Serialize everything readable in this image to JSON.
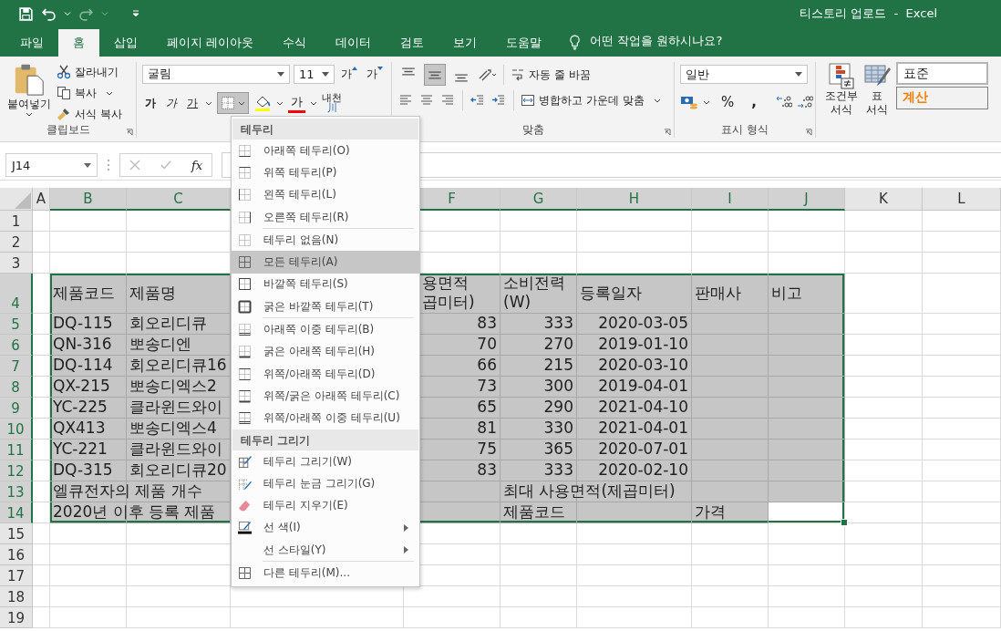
{
  "title_bar": {
    "title": "티스토리 업로드  -  Excel",
    "redo_disabled": true
  },
  "tabs": [
    {
      "label": "파일",
      "selected": false
    },
    {
      "label": "홈",
      "selected": true
    },
    {
      "label": "삽입",
      "selected": false
    },
    {
      "label": "페이지 레이아웃",
      "selected": false
    },
    {
      "label": "수식",
      "selected": false
    },
    {
      "label": "데이터",
      "selected": false
    },
    {
      "label": "검토",
      "selected": false
    },
    {
      "label": "보기",
      "selected": false
    },
    {
      "label": "도움말",
      "selected": false
    }
  ],
  "tell_me": {
    "text": "어떤 작업을 원하시나요?"
  },
  "clipboard": {
    "paste": "붙여넣기",
    "cut": "잘라내기",
    "copy": "복사",
    "format_painter": "서식 복사",
    "label": "클립보드"
  },
  "font": {
    "font_name": "굴림",
    "font_size": "11",
    "grow": "가",
    "shrink": "가",
    "bold": "가",
    "italic": "가",
    "underline": "가",
    "border_pressed": true,
    "font_color": "가",
    "phonetic_top": "내천",
    "phonetic_bottom": "川"
  },
  "alignment": {
    "vertical": [
      {
        "kind": "top",
        "selected": false
      },
      {
        "kind": "middle",
        "selected": true
      },
      {
        "kind": "bottom",
        "selected": false
      }
    ],
    "wrap": "자동 줄 바꿈",
    "merge": "병합하고 가운데 맞춤",
    "label": "맞춤"
  },
  "number": {
    "format": "일반",
    "percent": "%",
    "comma": ",",
    "label": "표시 형식"
  },
  "styles": {
    "conditional": "조건부\n서식",
    "table": "표\n서식",
    "cell_styles": [
      {
        "label": "표준",
        "kind": "normal"
      },
      {
        "label": "계산",
        "kind": "calculation"
      }
    ]
  },
  "formula_bar": {
    "name_box": "J14",
    "fx": "fx"
  },
  "sheet": {
    "columns": [
      {
        "label": "A",
        "selected": false
      },
      {
        "label": "B",
        "selected": true
      },
      {
        "label": "C",
        "selected": true
      },
      {
        "label": "F",
        "selected": true
      },
      {
        "label": "G",
        "selected": true
      },
      {
        "label": "H",
        "selected": true
      },
      {
        "label": "I",
        "selected": true
      },
      {
        "label": "J",
        "selected": true
      },
      {
        "label": "K",
        "selected": false
      },
      {
        "label": "L",
        "selected": false
      }
    ],
    "rows": [
      {
        "number": "1",
        "selected": false
      },
      {
        "number": "2",
        "selected": false
      },
      {
        "number": "3",
        "selected": false
      },
      {
        "number": "4",
        "selected": true,
        "cells": [
          {
            "filled": false
          },
          {
            "text": "제품코드",
            "kind": "text",
            "filled": true
          },
          {
            "text": "제품명",
            "kind": "text",
            "filled": true
          },
          {
            "text": "용면적\n곱미터)",
            "kind": "partial",
            "filled": true
          },
          {
            "text": "소비전력\n(W)",
            "kind": "text",
            "filled": true
          },
          {
            "text": "등록일자",
            "kind": "text",
            "filled": true
          },
          {
            "text": "판매사",
            "kind": "text",
            "filled": true
          },
          {
            "text": "비고",
            "kind": "text",
            "filled": true
          },
          {
            "filled": false
          },
          {
            "filled": false
          }
        ]
      },
      {
        "number": "5",
        "selected": true,
        "cells": [
          {
            "filled": false
          },
          {
            "text": "DQ-115",
            "kind": "text",
            "filled": true
          },
          {
            "text": "회오리디큐",
            "kind": "text",
            "filled": true
          },
          {
            "text": "83",
            "kind": "number",
            "filled": true
          },
          {
            "text": "333",
            "kind": "number",
            "filled": true
          },
          {
            "text": "2020-03-05",
            "kind": "number",
            "filled": true
          },
          {
            "filled": true
          },
          {
            "filled": true
          },
          {
            "filled": false
          },
          {
            "filled": false
          }
        ]
      },
      {
        "number": "6",
        "selected": true,
        "cells": [
          {
            "filled": false
          },
          {
            "text": "QN-316",
            "kind": "text",
            "filled": true
          },
          {
            "text": "뽀송디엔",
            "kind": "text",
            "filled": true
          },
          {
            "text": "70",
            "kind": "number",
            "filled": true
          },
          {
            "text": "270",
            "kind": "number",
            "filled": true
          },
          {
            "text": "2019-01-10",
            "kind": "number",
            "filled": true
          },
          {
            "filled": true
          },
          {
            "filled": true
          },
          {
            "filled": false
          },
          {
            "filled": false
          }
        ]
      },
      {
        "number": "7",
        "selected": true,
        "cells": [
          {
            "filled": false
          },
          {
            "text": "DQ-114",
            "kind": "text",
            "filled": true
          },
          {
            "text": "회오리디큐16",
            "kind": "text",
            "filled": true
          },
          {
            "text": "66",
            "kind": "number",
            "filled": true
          },
          {
            "text": "215",
            "kind": "number",
            "filled": true
          },
          {
            "text": "2020-03-10",
            "kind": "number",
            "filled": true
          },
          {
            "filled": true
          },
          {
            "filled": true
          },
          {
            "filled": false
          },
          {
            "filled": false
          }
        ]
      },
      {
        "number": "8",
        "selected": true,
        "cells": [
          {
            "filled": false
          },
          {
            "text": "QX-215",
            "kind": "text",
            "filled": true
          },
          {
            "text": "뽀송디엑스2",
            "kind": "text",
            "filled": true
          },
          {
            "text": "73",
            "kind": "number",
            "filled": true
          },
          {
            "text": "300",
            "kind": "number",
            "filled": true
          },
          {
            "text": "2019-04-01",
            "kind": "number",
            "filled": true
          },
          {
            "filled": true
          },
          {
            "filled": true
          },
          {
            "filled": false
          },
          {
            "filled": false
          }
        ]
      },
      {
        "number": "9",
        "selected": true,
        "cells": [
          {
            "filled": false
          },
          {
            "text": "YC-225",
            "kind": "text",
            "filled": true
          },
          {
            "text": "클라윈드와이",
            "kind": "text",
            "filled": true
          },
          {
            "text": "65",
            "kind": "number",
            "filled": true
          },
          {
            "text": "290",
            "kind": "number",
            "filled": true
          },
          {
            "text": "2021-04-10",
            "kind": "number",
            "filled": true
          },
          {
            "filled": true
          },
          {
            "filled": true
          },
          {
            "filled": false
          },
          {
            "filled": false
          }
        ]
      },
      {
        "number": "10",
        "selected": true,
        "cells": [
          {
            "filled": false
          },
          {
            "text": "QX413",
            "kind": "text",
            "filled": true
          },
          {
            "text": "뽀송디엑스4",
            "kind": "text",
            "filled": true
          },
          {
            "text": "81",
            "kind": "number",
            "filled": true
          },
          {
            "text": "330",
            "kind": "number",
            "filled": true
          },
          {
            "text": "2021-04-01",
            "kind": "number",
            "filled": true
          },
          {
            "filled": true
          },
          {
            "filled": true
          },
          {
            "filled": false
          },
          {
            "filled": false
          }
        ]
      },
      {
        "number": "11",
        "selected": true,
        "cells": [
          {
            "filled": false
          },
          {
            "text": "YC-221",
            "kind": "text",
            "filled": true
          },
          {
            "text": "클라윈드와이",
            "kind": "text",
            "filled": true
          },
          {
            "text": "75",
            "kind": "number",
            "filled": true
          },
          {
            "text": "365",
            "kind": "number",
            "filled": true
          },
          {
            "text": "2020-07-01",
            "kind": "number",
            "filled": true
          },
          {
            "filled": true
          },
          {
            "filled": true
          },
          {
            "filled": false
          },
          {
            "filled": false
          }
        ]
      },
      {
        "number": "12",
        "selected": true,
        "cells": [
          {
            "filled": false
          },
          {
            "text": "DQ-315",
            "kind": "text",
            "filled": true
          },
          {
            "text": "회오리디큐20",
            "kind": "text",
            "filled": true
          },
          {
            "text": "83",
            "kind": "number",
            "filled": true
          },
          {
            "text": "333",
            "kind": "number",
            "filled": true
          },
          {
            "text": "2020-02-10",
            "kind": "number",
            "filled": true
          },
          {
            "filled": true
          },
          {
            "filled": true
          },
          {
            "filled": false
          },
          {
            "filled": false
          }
        ]
      },
      {
        "number": "13",
        "selected": true,
        "cells": [
          {
            "filled": false
          },
          {
            "text": "엘큐전자의 제품 개수",
            "kind": "text",
            "filled": true
          },
          {
            "filled": true
          },
          {
            "filled": true
          },
          {
            "text": "최대 사용면적(제곱미터)",
            "kind": "text",
            "filled": true
          },
          {
            "filled": true
          },
          {
            "filled": true
          },
          {
            "filled": true
          },
          {
            "filled": false
          },
          {
            "filled": false
          }
        ]
      },
      {
        "number": "14",
        "selected": true,
        "cells": [
          {
            "filled": false
          },
          {
            "text": "2020년 이후 등록 제품",
            "kind": "text",
            "filled": true
          },
          {
            "filled": true
          },
          {
            "filled": true
          },
          {
            "text": "제품코드",
            "kind": "text",
            "filled": true
          },
          {
            "filled": true
          },
          {
            "text": "가격",
            "kind": "text",
            "filled": true
          },
          {
            "filled": false
          },
          {
            "filled": false
          },
          {
            "filled": false
          }
        ]
      },
      {
        "number": "15",
        "selected": false
      },
      {
        "number": "16",
        "selected": false
      },
      {
        "number": "17",
        "selected": false
      },
      {
        "number": "18",
        "selected": false
      },
      {
        "number": "19",
        "selected": false
      }
    ]
  },
  "menu": {
    "sections": [
      {
        "title": "테두리",
        "items": [
          {
            "label": "아래쪽 테두리(O)",
            "kind": "bottom",
            "selected": false
          },
          {
            "label": "위쪽 테두리(P)",
            "kind": "top",
            "selected": false
          },
          {
            "label": "왼쪽 테두리(L)",
            "kind": "left",
            "selected": false
          },
          {
            "label": "오른쪽 테두리(R)",
            "kind": "right",
            "selected": false
          },
          {
            "label": "테두리 없음(N)",
            "kind": "none",
            "selected": false,
            "divider_before": true
          },
          {
            "label": "모든 테두리(A)",
            "kind": "all",
            "selected": true
          },
          {
            "label": "바깥쪽 테두리(S)",
            "kind": "outside",
            "selected": false
          },
          {
            "label": "굵은 바깥쪽 테두리(T)",
            "kind": "thick_outside",
            "selected": false
          },
          {
            "label": "아래쪽 이중 테두리(B)",
            "kind": "double_bottom",
            "selected": false,
            "divider_before": true
          },
          {
            "label": "굵은 아래쪽 테두리(H)",
            "kind": "thick_bottom",
            "selected": false
          },
          {
            "label": "위쪽/아래쪽 테두리(D)",
            "kind": "top_bottom",
            "selected": false
          },
          {
            "label": "위쪽/굵은 아래쪽 테두리(C)",
            "kind": "top_thick_bottom",
            "selected": false
          },
          {
            "label": "위쪽/아래쪽 이중 테두리(U)",
            "kind": "top_double_bottom",
            "selected": false
          }
        ]
      },
      {
        "title": "테두리 그리기",
        "items": [
          {
            "label": "테두리 그리기(W)",
            "kind": "draw",
            "selected": false
          },
          {
            "label": "테두리 눈금 그리기(G)",
            "kind": "draw_grid",
            "selected": false
          },
          {
            "label": "테두리 지우기(E)",
            "kind": "erase",
            "selected": false
          },
          {
            "label": "선 색(I)",
            "kind": "line_color",
            "selected": false,
            "submenu": true
          },
          {
            "label": "선 스타일(Y)",
            "kind": "line_style",
            "selected": false,
            "submenu": true
          },
          {
            "label": "다른 테두리(M)...",
            "kind": "all",
            "selected": false,
            "divider_before": true
          }
        ]
      }
    ]
  }
}
